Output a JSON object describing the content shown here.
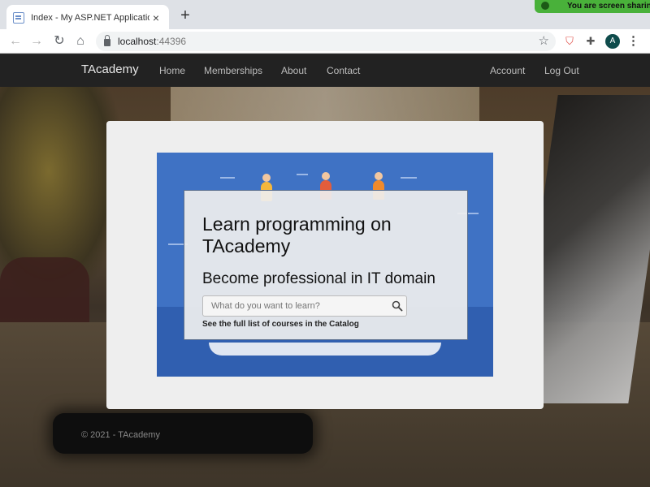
{
  "browser": {
    "tab_title": "Index - My ASP.NET Application",
    "tab_close": "×",
    "new_tab": "+",
    "url_host": "localhost",
    "url_port": ":44396",
    "avatar_letter": "A",
    "share_banner": "You are screen sharing"
  },
  "site": {
    "brand": "TAcademy",
    "nav_left": [
      "Home",
      "Memberships",
      "About",
      "Contact"
    ],
    "nav_right": [
      "Account",
      "Log Out"
    ],
    "footer": "© 2021 - TAcademy"
  },
  "hero": {
    "title": "Learn programming on TAcademy",
    "subtitle": "Become professional in IT domain",
    "search_placeholder": "What do you want to learn?",
    "catalog_link": "See the full list of courses in the Catalog"
  },
  "colors": {
    "illustration_blue": "#3f72c4",
    "nav_bg": "#222222",
    "share_green": "#49b13a"
  },
  "icons": [
    "back-icon",
    "forward-icon",
    "reload-icon",
    "home-icon",
    "lock-icon",
    "star-icon",
    "shield-icon",
    "puzzle-icon",
    "kebab-icon",
    "search-icon"
  ]
}
